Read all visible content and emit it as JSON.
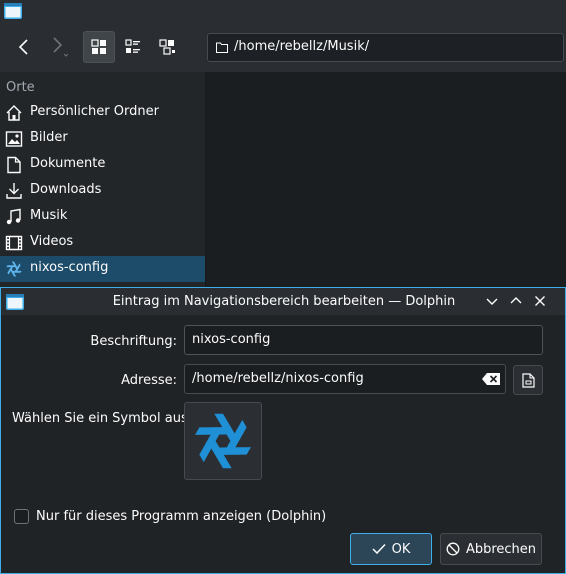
{
  "window": {
    "title": ""
  },
  "toolbar": {
    "back_icon": "chevron-left-icon",
    "forward_icon": "chevron-right-icon",
    "view_modes": [
      "icons-view-icon",
      "details-view-icon",
      "compact-view-icon"
    ],
    "location": "/home/rebellz/Musik/"
  },
  "sidebar": {
    "heading": "Orte",
    "items": [
      {
        "label": "Persönlicher Ordner",
        "icon": "home-icon"
      },
      {
        "label": "Bilder",
        "icon": "pictures-icon"
      },
      {
        "label": "Dokumente",
        "icon": "documents-icon"
      },
      {
        "label": "Downloads",
        "icon": "downloads-icon"
      },
      {
        "label": "Musik",
        "icon": "music-icon"
      },
      {
        "label": "Videos",
        "icon": "videos-icon"
      },
      {
        "label": "nixos-config",
        "icon": "nixos-snowflake-icon",
        "selected": true
      }
    ]
  },
  "dialog": {
    "title": "Eintrag im Navigationsbereich bearbeiten — Dolphin",
    "caption_label": "Beschriftung:",
    "caption_value": "nixos-config",
    "address_label": "Adresse:",
    "address_value": "/home/rebellz/nixos-config",
    "symbol_label": "Wählen Sie ein Symbol aus:",
    "symbol_icon": "nixos-snowflake-icon",
    "checkbox_label": "Nur für dieses Programm anzeigen (Dolphin)",
    "checkbox_checked": false,
    "ok_label": "OK",
    "cancel_label": "Abbrechen"
  },
  "colors": {
    "accent": "#3daee9",
    "selection": "#1d4c6b",
    "nixos_blue": "#1f8fd6"
  }
}
